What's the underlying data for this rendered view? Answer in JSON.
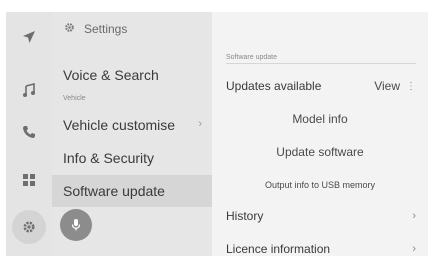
{
  "rail": {
    "icons": [
      "navigation-icon",
      "music-note-icon",
      "phone-icon",
      "apps-grid-icon",
      "settings-gear-icon"
    ]
  },
  "left_panel": {
    "header": "Settings",
    "items": [
      {
        "label": "Voice & Search"
      },
      {
        "label": "Vehicle customise"
      },
      {
        "label": "Info & Security"
      },
      {
        "label": "Software update"
      }
    ],
    "section_vehicle": "Vehicle",
    "chevron": "›"
  },
  "right_panel": {
    "section_label": "Software update",
    "updates_available": "Updates available",
    "view_label": "View",
    "kebab": "⋮",
    "model_info": "Model info",
    "update_software": "Update software",
    "output_usb": "Output info to USB memory",
    "history": "History",
    "licence": "Licence information",
    "chevron": "›"
  },
  "colors": {
    "background": "#ececec",
    "rail": "#e4e4e4",
    "selected": "#d6d6d6",
    "mic_button": "#8c8c8c"
  }
}
